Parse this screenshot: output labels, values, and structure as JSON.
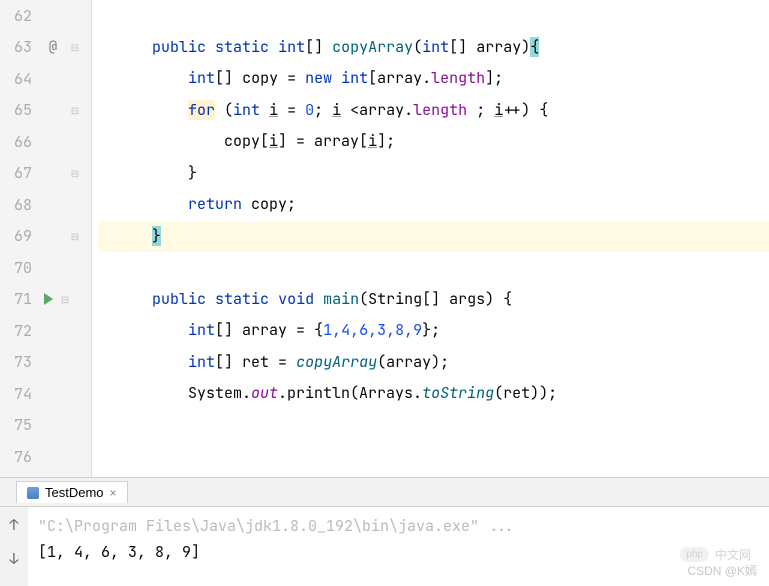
{
  "lines": [
    {
      "num": "62",
      "annot": "",
      "fold": "",
      "code": ""
    },
    {
      "num": "63",
      "annot": "@",
      "fold": "⊟",
      "code": "63"
    },
    {
      "num": "64",
      "annot": "",
      "fold": "",
      "code": "64"
    },
    {
      "num": "65",
      "annot": "",
      "fold": "⊟",
      "code": "65"
    },
    {
      "num": "66",
      "annot": "",
      "fold": "",
      "code": "66"
    },
    {
      "num": "67",
      "annot": "",
      "fold": "⊟",
      "code": "67"
    },
    {
      "num": "68",
      "annot": "",
      "fold": "",
      "code": "68"
    },
    {
      "num": "69",
      "annot": "",
      "fold": "⊟",
      "code": "69"
    },
    {
      "num": "70",
      "annot": "",
      "fold": "",
      "code": ""
    },
    {
      "num": "71",
      "annot": "run",
      "fold": "⊟",
      "code": "71"
    },
    {
      "num": "72",
      "annot": "",
      "fold": "",
      "code": "72"
    },
    {
      "num": "73",
      "annot": "",
      "fold": "",
      "code": "73"
    },
    {
      "num": "74",
      "annot": "",
      "fold": "",
      "code": "74"
    },
    {
      "num": "75",
      "annot": "",
      "fold": "",
      "code": ""
    },
    {
      "num": "76",
      "annot": "",
      "fold": "",
      "code": ""
    }
  ],
  "code": {
    "l63_public": "public",
    "l63_static": "static",
    "l63_int": "int",
    "l63_brackets": "[]",
    "l63_method": "copyArray",
    "l63_param_type": "int",
    "l63_param_br": "[]",
    "l63_param_name": "array",
    "l63_brace": "{",
    "l64_int": "int",
    "l64_br": "[]",
    "l64_copy": "copy",
    "l64_eq": " = ",
    "l64_new": "new",
    "l64_int2": "int",
    "l64_open": "[array.",
    "l64_length": "length",
    "l64_close": "];",
    "l65_for": "for",
    "l65_open": " (",
    "l65_int": "int",
    "l65_i": "i",
    "l65_eq": " = ",
    "l65_zero": "0",
    "l65_semi": "; ",
    "l65_i2": "i",
    "l65_lt": " <array.",
    "l65_length": "length",
    "l65_semi2": " ; ",
    "l65_i3": "i",
    "l65_inc": "++) {",
    "l66_body": "copy[",
    "l66_i": "i",
    "l66_mid": "] = array[",
    "l66_i2": "i",
    "l66_end": "];",
    "l67_brace": "}",
    "l68_return": "return",
    "l68_copy": " copy;",
    "l69_brace": "}",
    "l71_public": "public",
    "l71_static": "static",
    "l71_void": "void",
    "l71_main": "main",
    "l71_paren": "(String[] args) {",
    "l72_int": "int",
    "l72_br": "[]",
    "l72_arr": " array = {",
    "l72_nums": "1,4,6,3,8,9",
    "l72_end": "};",
    "l73_int": "int",
    "l73_br": "[]",
    "l73_ret": " ret = ",
    "l73_call": "copyArray",
    "l73_arg": "(array);",
    "l74_sys": "System.",
    "l74_out": "out",
    "l74_print": ".println(Arrays.",
    "l74_tostr": "toString",
    "l74_arg": "(ret));"
  },
  "console": {
    "tab_name": "TestDemo",
    "cmd": "\"C:\\Program Files\\Java\\jdk1.8.0_192\\bin\\java.exe\" ...",
    "output": "[1, 4, 6, 3, 8, 9]"
  },
  "watermark": {
    "php": "php",
    "cn": "中文网",
    "csdn": "CSDN @K嫣"
  }
}
